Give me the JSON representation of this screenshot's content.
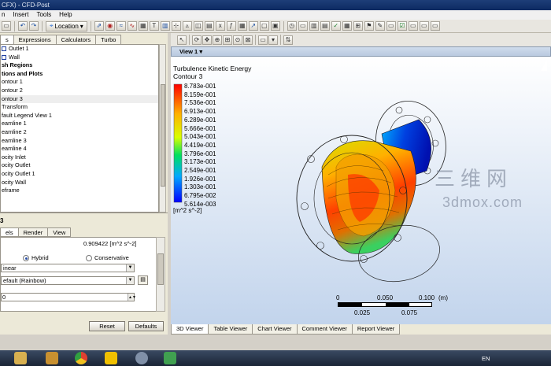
{
  "window": {
    "title": "CFX) - CFD-Post"
  },
  "menu": {
    "items": [
      "n",
      "Insert",
      "Tools",
      "Help"
    ]
  },
  "toolbar": {
    "location_label": "Location"
  },
  "left_tabs": [
    "s",
    "Expressions",
    "Calculators",
    "Turbo"
  ],
  "tree": [
    {
      "label": "Outlet 1",
      "bold": false,
      "icon": "mesh"
    },
    {
      "label": "Wall",
      "bold": false,
      "icon": "mesh"
    },
    {
      "label": "sh Regions",
      "bold": true
    },
    {
      "label": "tions and Plots",
      "bold": true
    },
    {
      "label": "ontour 1"
    },
    {
      "label": "ontour 2"
    },
    {
      "label": "ontour 3",
      "selected": true
    },
    {
      "label": "Transform"
    },
    {
      "label": "fault Legend View 1"
    },
    {
      "label": "eamline 1"
    },
    {
      "label": "eamline 2"
    },
    {
      "label": "eamline 3"
    },
    {
      "label": "eamline 4"
    },
    {
      "label": "ocity Inlet"
    },
    {
      "label": "ocity Outlet"
    },
    {
      "label": "ocity Outlet 1"
    },
    {
      "label": "ocity Wall"
    },
    {
      "label": "eframe"
    }
  ],
  "details": {
    "title": "3",
    "tabs": [
      "els",
      "Render",
      "View"
    ],
    "range_value": "0.909422 [m^2 s^-2]",
    "hybrid_label": "Hybrid",
    "conservative_label": "Conservative",
    "combo1": "inear",
    "combo2": "efault (Rainbow)",
    "number_field": "0",
    "reset_label": "Reset",
    "defaults_label": "Defaults"
  },
  "viewer": {
    "view_tab": "View 1",
    "plot_title": "Turbulence Kinetic Energy",
    "plot_subtitle": "Contour 3",
    "legend_values": [
      "8.783e-001",
      "8.159e-001",
      "7.536e-001",
      "6.913e-001",
      "6.289e-001",
      "5.666e-001",
      "5.043e-001",
      "4.419e-001",
      "3.796e-001",
      "3.173e-001",
      "2.549e-001",
      "1.926e-001",
      "1.303e-001",
      "6.795e-002",
      "5.614e-003"
    ],
    "units": "[m^2 s^-2]",
    "scale_top": [
      "0",
      "0.050",
      "0.100",
      "(m)"
    ],
    "scale_bottom": [
      "0.025",
      "0.075"
    ],
    "watermark_cn": "三维网",
    "watermark_url": "3dmox.com",
    "tabs": [
      "3D Viewer",
      "Table Viewer",
      "Chart Viewer",
      "Comment Viewer",
      "Report Viewer"
    ]
  },
  "taskbar": {
    "lang": "EN"
  }
}
